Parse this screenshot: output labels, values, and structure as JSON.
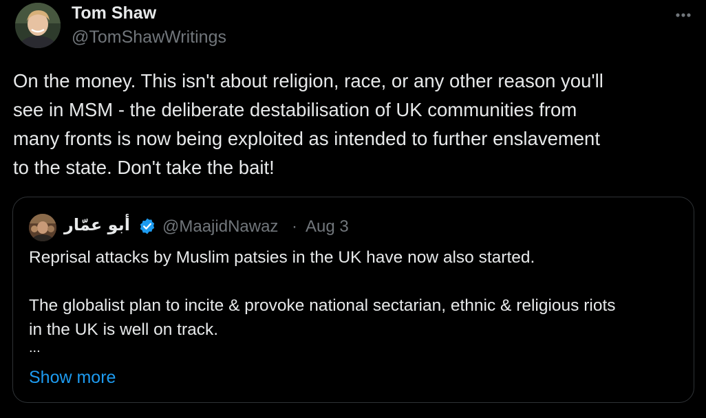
{
  "author": {
    "name": "Tom Shaw",
    "handle": "@TomShawWritings"
  },
  "tweet": {
    "text_lines": [
      "On the money. This isn't about religion, race, or any other reason you'll",
      "see in MSM - the deliberate destabilisation of UK communities from",
      "many fronts is now being exploited as intended to further enslavement",
      "to the state. Don't take the bait!"
    ]
  },
  "quoted": {
    "name": "أبو عمّار",
    "verified": true,
    "handle": "@MaajidNawaz",
    "separator": "·",
    "date": "Aug 3",
    "lines": [
      "Reprisal attacks by Muslim patsies in the UK have now also started.",
      "",
      "The globalist plan to incite & provoke national sectarian, ethnic & religious riots",
      "in the UK is well on track."
    ],
    "ellipsis": "...",
    "show_more_label": "Show more"
  },
  "icons": {
    "more": "more-horizontal-icon",
    "verified": "verified-badge-icon"
  },
  "colors": {
    "background": "#000000",
    "text": "#e7e9ea",
    "secondary": "#71767b",
    "link": "#1d9bf0",
    "border": "#2f3336",
    "verified": "#1d9bf0"
  }
}
